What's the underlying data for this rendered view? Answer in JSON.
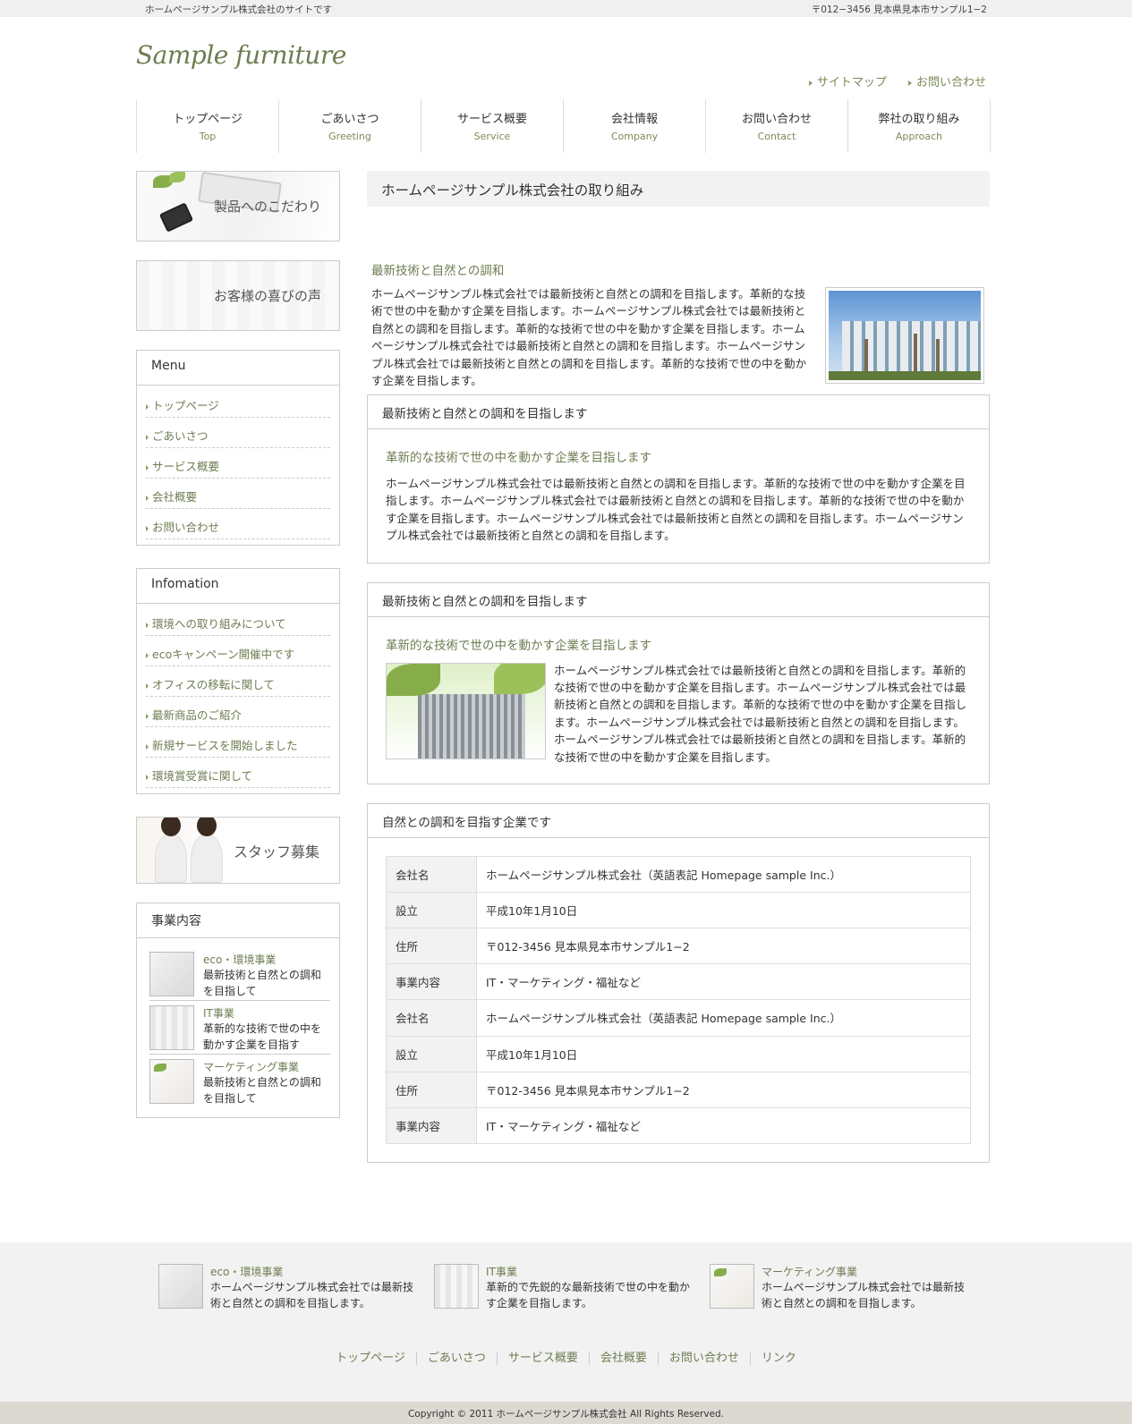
{
  "topbar": {
    "tagline": "ホームページサンプル株式会社のサイトです",
    "address": "〒012−3456 見本県見本市サンプル1−2"
  },
  "header": {
    "logo": "Sample furniture",
    "links": [
      "サイトマップ",
      "お問い合わせ"
    ]
  },
  "nav": [
    {
      "jp": "トップページ",
      "en": "Top"
    },
    {
      "jp": "ごあいさつ",
      "en": "Greeting"
    },
    {
      "jp": "サービス概要",
      "en": "Service"
    },
    {
      "jp": "会社情報",
      "en": "Company"
    },
    {
      "jp": "お問い合わせ",
      "en": "Contact"
    },
    {
      "jp": "弊社の取り組み",
      "en": "Approach"
    }
  ],
  "side": {
    "banner1": "製品へのこだわり",
    "banner2": "お客様の喜びの声",
    "menu_title": "Menu",
    "menu": [
      "トップページ",
      "ごあいさつ",
      "サービス概要",
      "会社概要",
      "お問い合わせ"
    ],
    "info_title": "Infomation",
    "info": [
      "環境への取り組みについて",
      "ecoキャンペーン開催中です",
      "オフィスの移転に関して",
      "最新商品のご紹介",
      "新規サービスを開始しました",
      "環境賞受賞に関して"
    ],
    "banner3": "スタッフ募集",
    "biz_title": "事業内容",
    "biz": [
      {
        "title": "eco・環境事業",
        "desc": "最新技術と自然との調和を目指して"
      },
      {
        "title": "IT事業",
        "desc": "革新的な技術で世の中を動かす企業を目指す"
      },
      {
        "title": "マーケティング事業",
        "desc": "最新技術と自然との調和を目指して"
      }
    ]
  },
  "main": {
    "page_title": "ホームページサンプル株式会社の取り組み",
    "intro_heading": "最新技術と自然との調和",
    "intro_text": "ホームページサンプル株式会社では最新技術と自然との調和を目指します。革新的な技術で世の中を動かす企業を目指します。ホームページサンプル株式会社では最新技術と自然との調和を目指します。革新的な技術で世の中を動かす企業を目指します。ホームページサンプル株式会社では最新技術と自然との調和を目指します。ホームページサンプル株式会社では最新技術と自然との調和を目指します。革新的な技術で世の中を動かす企業を目指します。",
    "box1": {
      "header": "最新技術と自然との調和を目指します",
      "heading": "革新的な技術で世の中を動かす企業を目指します",
      "text": "ホームページサンプル株式会社では最新技術と自然との調和を目指します。革新的な技術で世の中を動かす企業を目指します。ホームページサンプル株式会社では最新技術と自然との調和を目指します。革新的な技術で世の中を動かす企業を目指します。ホームページサンプル株式会社では最新技術と自然との調和を目指します。ホームページサンプル株式会社では最新技術と自然との調和を目指します。"
    },
    "box2": {
      "header": "最新技術と自然との調和を目指します",
      "heading": "革新的な技術で世の中を動かす企業を目指します",
      "text": "ホームページサンプル株式会社では最新技術と自然との調和を目指します。革新的な技術で世の中を動かす企業を目指します。ホームページサンプル株式会社では最新技術と自然との調和を目指します。革新的な技術で世の中を動かす企業を目指します。ホームページサンプル株式会社では最新技術と自然との調和を目指します。ホームページサンプル株式会社では最新技術と自然との調和を目指します。革新的な技術で世の中を動かす企業を目指します。"
    },
    "box3": {
      "header": "自然との調和を目指す企業です",
      "rows": [
        [
          "会社名",
          "ホームページサンプル株式会社（英語表記 Homepage sample Inc.）"
        ],
        [
          "設立",
          "平成10年1月10日"
        ],
        [
          "住所",
          "〒012-3456 見本県見本市サンプル1−2"
        ],
        [
          "事業内容",
          "IT・マーケティング・福祉など"
        ],
        [
          "会社名",
          "ホームページサンプル株式会社（英語表記 Homepage sample Inc.）"
        ],
        [
          "設立",
          "平成10年1月10日"
        ],
        [
          "住所",
          "〒012-3456 見本県見本市サンプル1−2"
        ],
        [
          "事業内容",
          "IT・マーケティング・福祉など"
        ]
      ]
    }
  },
  "footer": {
    "items": [
      {
        "title": "eco・環境事業",
        "desc": "ホームページサンプル株式会社では最新技術と自然との調和を目指します。"
      },
      {
        "title": "IT事業",
        "desc": "革新的で先鋭的な最新技術で世の中を動かす企業を目指します。"
      },
      {
        "title": "マーケティング事業",
        "desc": "ホームページサンプル株式会社では最新技術と自然との調和を目指します。"
      }
    ],
    "nav": [
      "トップページ",
      "ごあいさつ",
      "サービス概要",
      "会社概要",
      "お問い合わせ",
      "リンク"
    ],
    "copyright": "Copyright © 2011 ホームページサンプル株式会社 All Rights Reserved."
  }
}
